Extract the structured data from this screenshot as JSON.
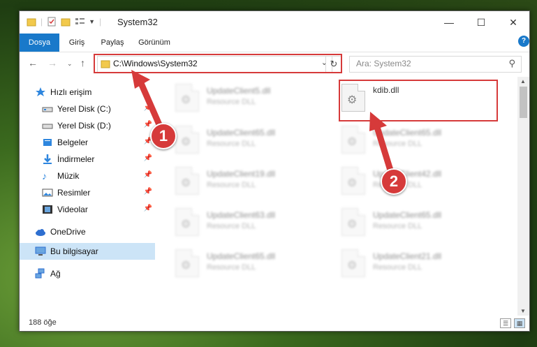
{
  "window": {
    "title": "System32",
    "controls": {
      "minimize": "—",
      "maximize": "☐",
      "close": "✕"
    }
  },
  "ribbon": {
    "tabs": [
      "Dosya",
      "Giriş",
      "Paylaş",
      "Görünüm"
    ],
    "help_icon": "?"
  },
  "nav": {
    "address": "C:\\Windows\\System32",
    "search_placeholder": "Ara: System32"
  },
  "sidebar": {
    "items": [
      {
        "label": "Hızlı erişim",
        "icon": "star-icon",
        "pinned": false
      },
      {
        "label": "Yerel Disk (C:)",
        "icon": "drive-icon",
        "pinned": true
      },
      {
        "label": "Yerel Disk (D:)",
        "icon": "drive-icon",
        "pinned": true
      },
      {
        "label": "Belgeler",
        "icon": "documents-icon",
        "pinned": true
      },
      {
        "label": "İndirmeler",
        "icon": "download-icon",
        "pinned": true
      },
      {
        "label": "Müzik",
        "icon": "music-icon",
        "pinned": true
      },
      {
        "label": "Resimler",
        "icon": "pictures-icon",
        "pinned": true
      },
      {
        "label": "Videolar",
        "icon": "video-icon",
        "pinned": true
      },
      {
        "label": "OneDrive",
        "icon": "cloud-icon",
        "pinned": false
      },
      {
        "label": "Bu bilgisayar",
        "icon": "computer-icon",
        "pinned": false,
        "selected": true
      },
      {
        "label": "Ağ",
        "icon": "network-icon",
        "pinned": false
      }
    ]
  },
  "files": {
    "left": [
      {
        "name": "UpdateClient5.dll",
        "type": "Resource DLL"
      },
      {
        "name": "UpdateClient65.dll",
        "type": "Resource DLL"
      },
      {
        "name": "UpdateClient19.dll",
        "type": "Resource DLL"
      },
      {
        "name": "UpdateClient63.dll",
        "type": "Resource DLL"
      },
      {
        "name": "UpdateClient65.dll",
        "type": "Resource DLL"
      }
    ],
    "right": [
      {
        "name": "kdib.dll",
        "type": ""
      },
      {
        "name": "UpdateClient65.dll",
        "type": "Resource DLL"
      },
      {
        "name": "UpdateClient42.dll",
        "type": "Resource DLL"
      },
      {
        "name": "UpdateClient65.dll",
        "type": "Resource DLL"
      },
      {
        "name": "UpdateClient21.dll",
        "type": "Resource DLL"
      }
    ]
  },
  "status": {
    "item_count": "188 öğe"
  },
  "annotations": {
    "badge1": "1",
    "badge2": "2"
  },
  "colors": {
    "accent": "#1979ca",
    "highlight": "#d63a3a"
  }
}
